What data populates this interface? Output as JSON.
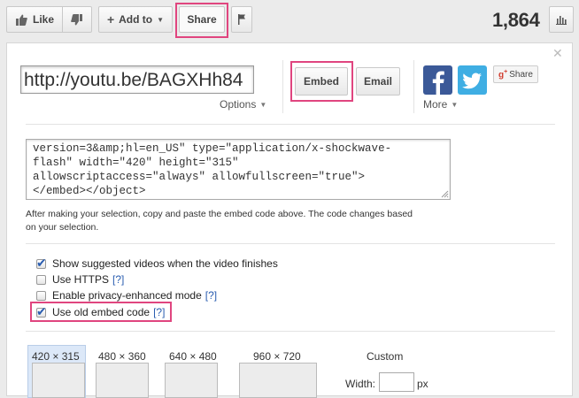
{
  "toolbar": {
    "like_label": "Like",
    "add_to_label": "Add to",
    "share_label": "Share",
    "view_count": "1,864"
  },
  "share_panel": {
    "url": "http://youtu.be/BAGXHh84",
    "options_label": "Options",
    "embed_label": "Embed",
    "email_label": "Email",
    "gplus_label": "Share",
    "more_label": "More",
    "embed_code_lines": [
      "version=3&amp;hl=en_US\" type=\"application/x-shockwave-",
      "flash\" width=\"420\" height=\"315\"",
      "allowscriptaccess=\"always\" allowfullscreen=\"true\">",
      "</embed></object>"
    ],
    "hint_line1": "After making your selection, copy and paste the embed code above. The code changes based",
    "hint_line2": "on your selection.",
    "checkboxes": [
      {
        "label": "Show suggested videos when the video finishes",
        "checked": true,
        "help": ""
      },
      {
        "label": "Use HTTPS",
        "checked": false,
        "help": "[?]"
      },
      {
        "label": "Enable privacy-enhanced mode",
        "checked": false,
        "help": "[?]"
      },
      {
        "label": "Use old embed code",
        "checked": true,
        "help": "[?]"
      }
    ],
    "sizes": [
      "420 × 315",
      "480 × 360",
      "640 × 480",
      "960 × 720"
    ],
    "selected_size": "420 × 315",
    "custom_label": "Custom",
    "width_label": "Width:",
    "px_label": "px"
  },
  "colors": {
    "highlight": "#e0457f",
    "link": "#2a5db0",
    "facebook": "#3b5998",
    "twitter": "#3faee3"
  }
}
